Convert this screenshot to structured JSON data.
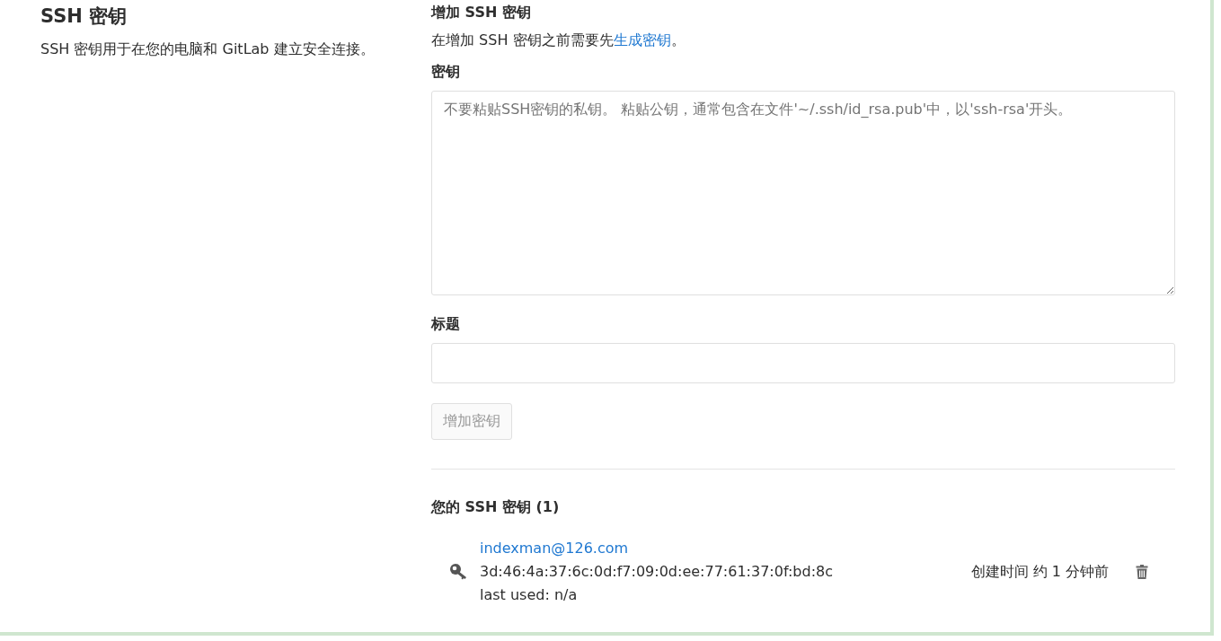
{
  "intro": {
    "title": "SSH 密钥",
    "description": "SSH 密钥用于在您的电脑和 GitLab 建立安全连接。"
  },
  "add_form": {
    "title": "增加 SSH 密钥",
    "notice": "在增加 SSH 密钥之前需要先",
    "notice_link": "生成密钥",
    "notice_end": "。",
    "key_field": {
      "label": "密钥",
      "placeholder": "不要粘贴SSH密钥的私钥。 粘贴公钥，通常包含在文件'~/.ssh/id_rsa.pub'中，以'ssh-rsa'开头。"
    },
    "title_field": {
      "label": "标题"
    },
    "submit": {
      "label": "增加密钥",
      "disabled": true
    }
  },
  "keys_list": {
    "title": "您的 SSH 密钥 (1)",
    "keys": [
      {
        "name": "indexman@126.com",
        "fingerprint": "3d:46:4a:37:6c:0d:f7:09:0d:ee:77:61:37:0f:bd:8c",
        "last_used": "last used: n/a",
        "created": "创建时间 约 1 分钟前"
      }
    ]
  }
}
